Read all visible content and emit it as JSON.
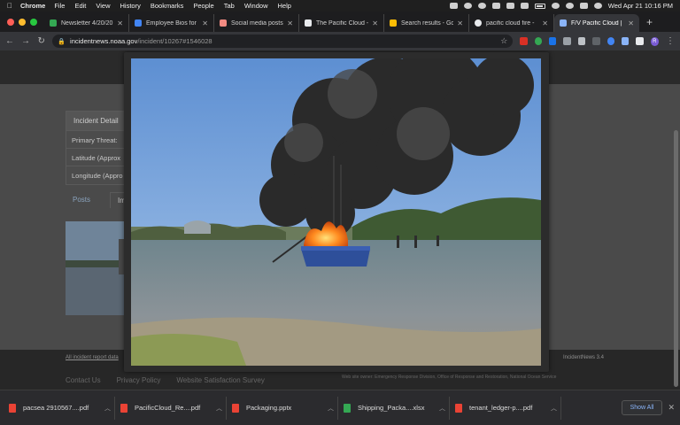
{
  "menubar": {
    "app_name": "Chrome",
    "items": [
      "File",
      "Edit",
      "View",
      "History",
      "Bookmarks",
      "People",
      "Tab",
      "Window",
      "Help"
    ],
    "clock": "Wed Apr 21  10:16 PM"
  },
  "tabs": [
    {
      "title": "Newsletter 4/20/20",
      "color": "#34a853"
    },
    {
      "title": "Employee Bios for I",
      "color": "#4285f4"
    },
    {
      "title": "Social media posts",
      "color": "#f28b82"
    },
    {
      "title": "The Pacific Cloud -",
      "color": "#e8eaed"
    },
    {
      "title": "Search results - Go",
      "color": "#fbbc04"
    },
    {
      "title": "pacific cloud fire -",
      "color": "#e8eaed"
    },
    {
      "title": "F/V Pacific Cloud | I",
      "color": "#8ab4f8",
      "active": true
    }
  ],
  "toolbar": {
    "domain": "incidentnews.noaa.gov",
    "path": "/incident/10267#1546028"
  },
  "page": {
    "details_title": "Incident Detail",
    "rows": [
      "Primary Threat:",
      "Latitude (Approx",
      "Longitude (Appro"
    ],
    "tabs": [
      "Posts",
      "Images"
    ],
    "footer_link": "All incident report data",
    "version": "IncidentNews 3.4",
    "footer_links": [
      "Contact Us",
      "Privacy Policy",
      "Website Satisfaction Survey"
    ],
    "credit": "Web site owner: Emergency Response Division, Office of Response and Restoration, National Ocean Service"
  },
  "downloads": {
    "items": [
      {
        "name": "pacsea 2910567....pdf",
        "color": "#ea4335"
      },
      {
        "name": "PacificCloud_Re....pdf",
        "color": "#ea4335"
      },
      {
        "name": "Packaging.pptx",
        "color": "#ea4335"
      },
      {
        "name": "Shipping_Packa....xlsx",
        "color": "#34a853"
      },
      {
        "name": "tenant_ledger-p....pdf",
        "color": "#ea4335"
      }
    ],
    "show_all": "Show All"
  }
}
